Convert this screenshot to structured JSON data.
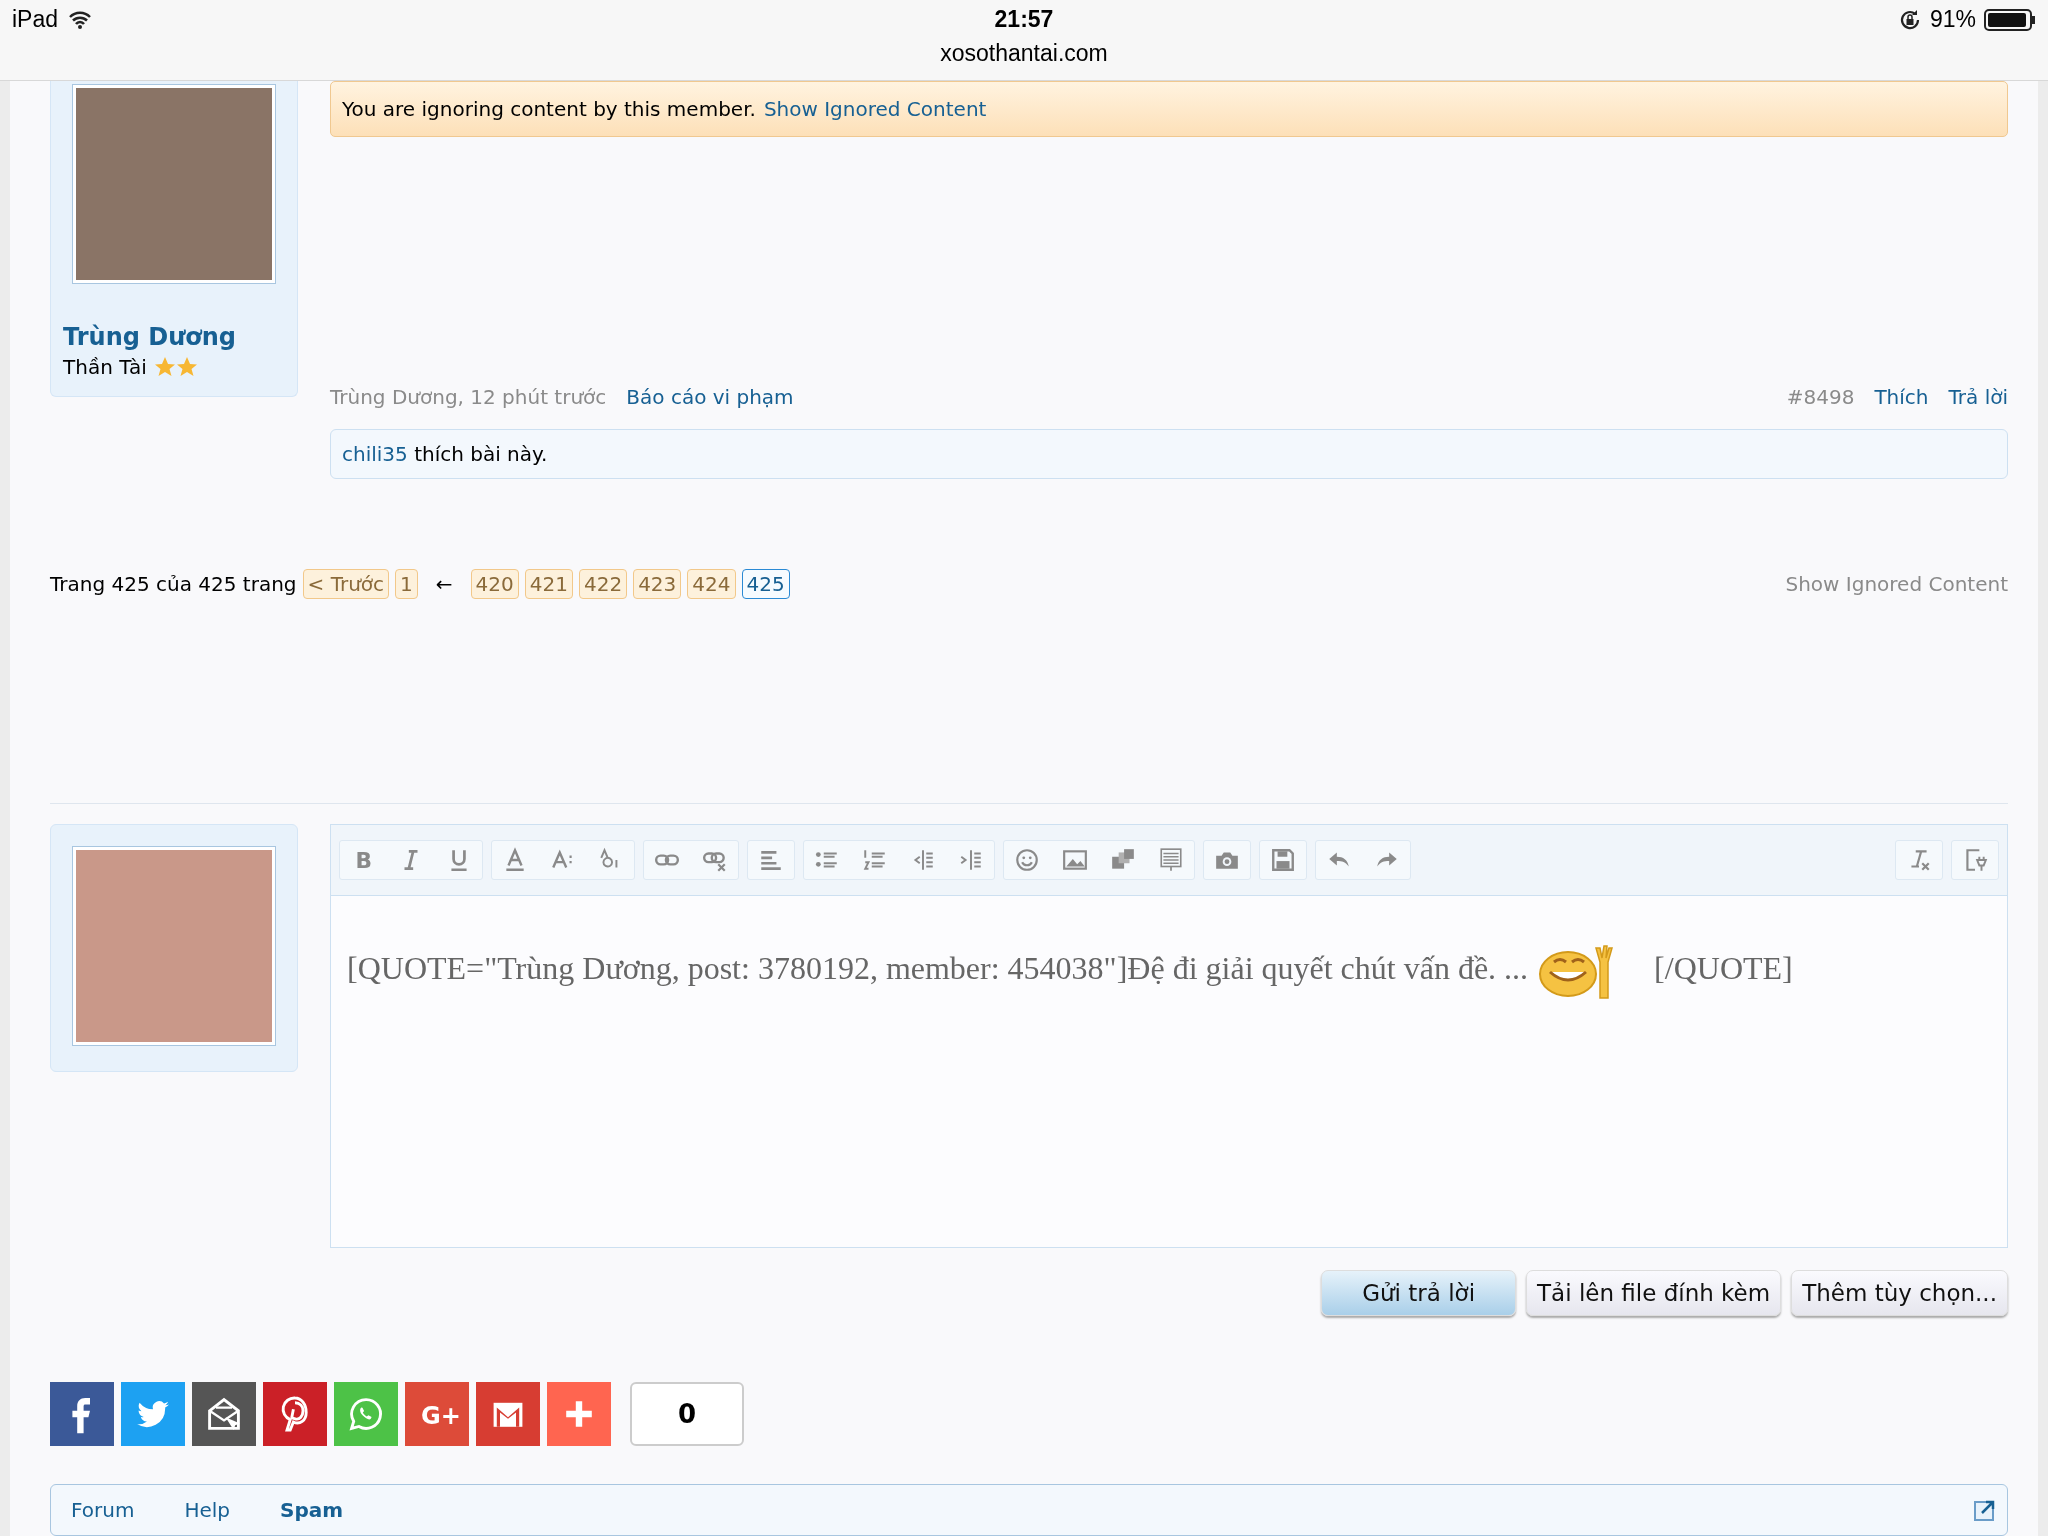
{
  "status_bar": {
    "device": "iPad",
    "time": "21:57",
    "url": "xosothantai.com",
    "battery": "91%"
  },
  "post": {
    "author": "Trùng Dương",
    "rank": "Thần Tài",
    "notice": "You are ignoring content by this member.",
    "notice_link": "Show Ignored Content",
    "meta_author": "Trùng Dương, 12 phút trước",
    "report": "Báo cáo vi phạm",
    "number": "#8498",
    "like": "Thích",
    "reply": "Trả lời",
    "liker": "chili35",
    "likes_text": " thích bài này."
  },
  "pagination": {
    "label": "Trang 425 của 425 trang",
    "prev": "< Trước",
    "first": "1",
    "arrow": "←",
    "pages": [
      {
        "label": "420",
        "selected": false
      },
      {
        "label": "421",
        "selected": false
      },
      {
        "label": "422",
        "selected": false
      },
      {
        "label": "423",
        "selected": false
      },
      {
        "label": "424",
        "selected": false
      },
      {
        "label": "425",
        "selected": true
      }
    ],
    "show_ignored": "Show Ignored Content"
  },
  "editor": {
    "bold_label": "B",
    "text_before": "[QUOTE=\"Trùng Dương, post: 3780192, member: 454038\"]Đệ đi giải quyết chút vấn đề. ...",
    "text_after": "[/QUOTE]"
  },
  "buttons": [
    {
      "label": "Gửi trả lời",
      "primary": true
    },
    {
      "label": "Tải lên file đính kèm",
      "primary": false
    },
    {
      "label": "Thêm tùy chọn...",
      "primary": false
    }
  ],
  "share": {
    "google_plus_label": "G+",
    "count": "0"
  },
  "breadcrumb": [
    {
      "label": "Forum",
      "current": false
    },
    {
      "label": "Help",
      "current": false
    },
    {
      "label": "Spam",
      "current": true
    }
  ]
}
